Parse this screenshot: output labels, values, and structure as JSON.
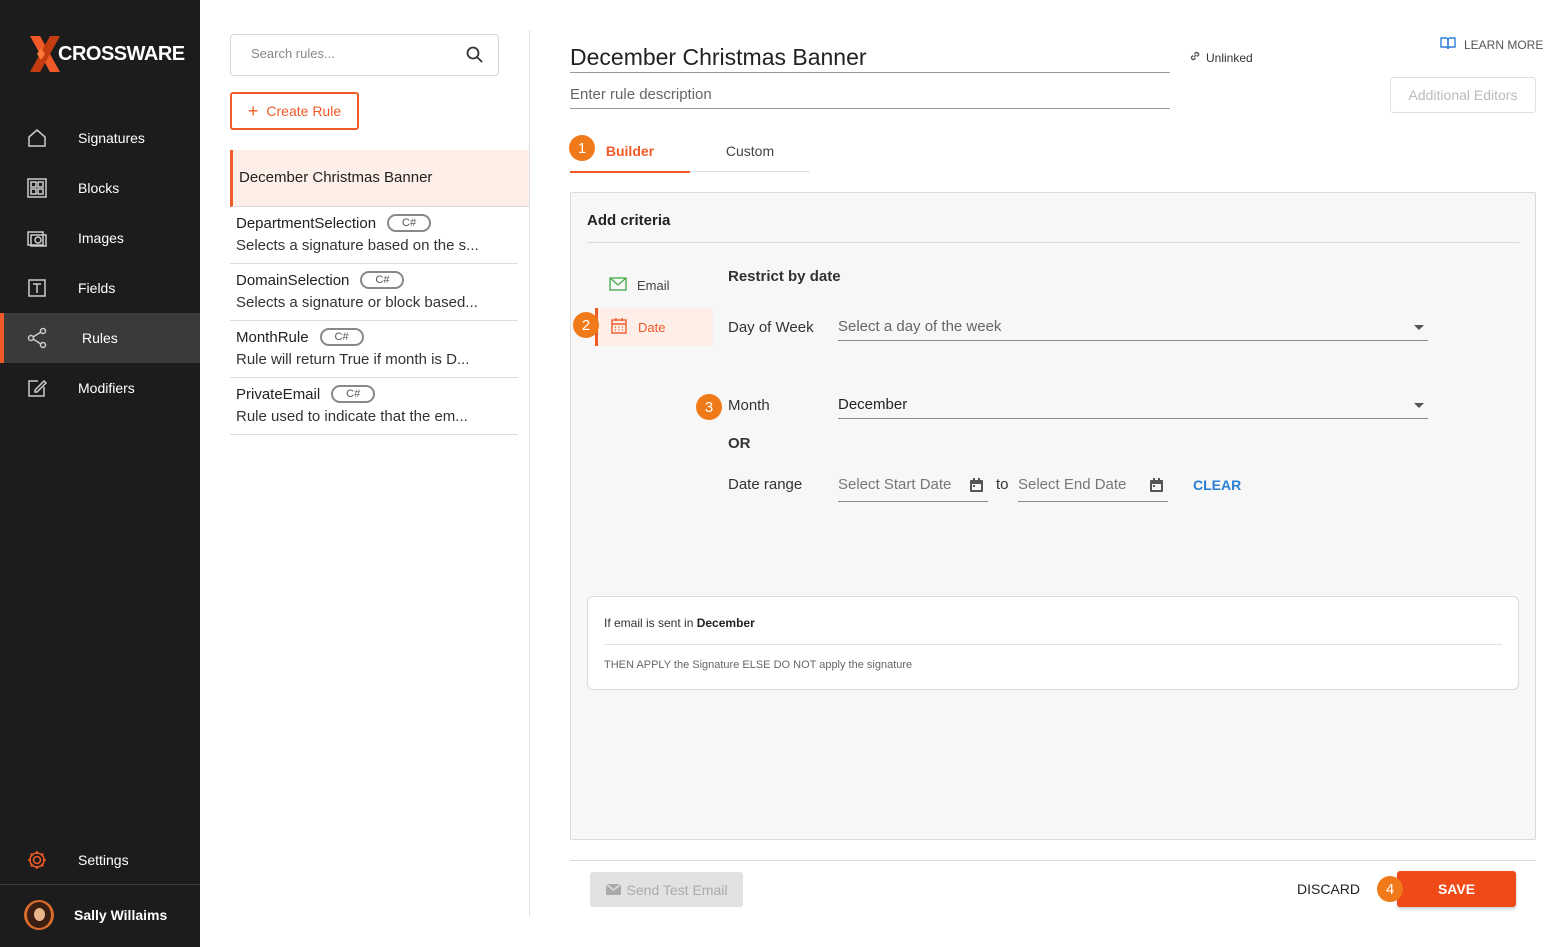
{
  "app": {
    "brand": "CROSSWARE",
    "accent": "#f05a28"
  },
  "sidebar": {
    "items": [
      {
        "label": "Signatures",
        "icon": "home-icon"
      },
      {
        "label": "Blocks",
        "icon": "blocks-icon"
      },
      {
        "label": "Images",
        "icon": "images-icon"
      },
      {
        "label": "Fields",
        "icon": "fields-icon"
      },
      {
        "label": "Rules",
        "icon": "share-icon",
        "active": true
      },
      {
        "label": "Modifiers",
        "icon": "edit-icon"
      }
    ],
    "settings_label": "Settings",
    "user_name": "Sally Willaims"
  },
  "rules_panel": {
    "search_placeholder": "Search rules...",
    "create_label": "Create Rule",
    "selected": "December Christmas Banner",
    "rules": [
      {
        "name": "DepartmentSelection",
        "badge": "C#",
        "desc": "Selects a signature based on the s..."
      },
      {
        "name": "DomainSelection",
        "badge": "C#",
        "desc": "Selects a signature or block based..."
      },
      {
        "name": "MonthRule",
        "badge": "C#",
        "desc": "Rule will return True if month is D..."
      },
      {
        "name": "PrivateEmail",
        "badge": "C#",
        "desc": "Rule used to indicate that the em..."
      }
    ]
  },
  "editor": {
    "title": "December Christmas Banner",
    "desc_placeholder": "Enter rule description",
    "unlinked_label": "Unlinked",
    "learn_more": "LEARN MORE",
    "additional_editors": "Additional Editors",
    "tabs": {
      "builder": "Builder",
      "custom": "Custom"
    },
    "steps": [
      "1",
      "2",
      "3",
      "4"
    ],
    "criteria": {
      "title": "Add criteria",
      "categories": {
        "email": "Email",
        "date": "Date"
      },
      "restrict_title": "Restrict by date",
      "day_of_week_label": "Day of Week",
      "day_of_week_value": "Select a day of the week",
      "month_label": "Month",
      "month_value": "December",
      "or_label": "OR",
      "date_range_label": "Date range",
      "start_date": "Select Start Date",
      "to_label": "to",
      "end_date": "Select End Date",
      "clear_label": "CLEAR"
    },
    "summary": {
      "prefix": "If email is sent in",
      "month": "December",
      "then": "THEN APPLY the Signature ELSE DO NOT apply the signature"
    },
    "footer": {
      "send_test": "Send Test Email",
      "discard": "DISCARD",
      "save": "SAVE"
    }
  }
}
